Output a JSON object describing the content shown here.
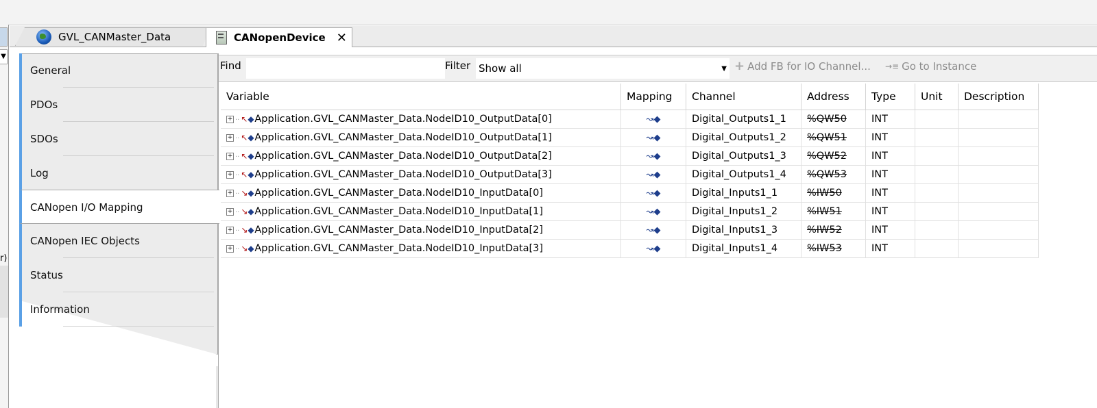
{
  "tabs": [
    {
      "label": "GVL_CANMaster_Data",
      "icon": "globe-icon"
    },
    {
      "label": "CANopenDevice",
      "icon": "device-icon",
      "close": "✕",
      "active": true
    }
  ],
  "sidebar": {
    "items": [
      {
        "label": "General"
      },
      {
        "label": "PDOs"
      },
      {
        "label": "SDOs"
      },
      {
        "label": "Log"
      },
      {
        "label": "CANopen I/O Mapping",
        "active": true
      },
      {
        "label": "CANopen IEC Objects"
      },
      {
        "label": "Status"
      },
      {
        "label": "Information"
      }
    ]
  },
  "toolbar": {
    "find_label": "Find",
    "find_value": "",
    "filter_label": "Filter",
    "filter_value": "Show all",
    "add_fb_label": "Add FB for IO Channel...",
    "goto_label": "Go to Instance"
  },
  "table": {
    "headers": [
      "Variable",
      "Mapping",
      "Channel",
      "Address",
      "Type",
      "Unit",
      "Description"
    ],
    "rows": [
      {
        "variable": "Application.GVL_CANMaster_Data.NodeID10_OutputData[0]",
        "channel": "Digital_Outputs1_1",
        "address": "%QW50",
        "type": "INT",
        "unit": "",
        "description": ""
      },
      {
        "variable": "Application.GVL_CANMaster_Data.NodeID10_OutputData[1]",
        "channel": "Digital_Outputs1_2",
        "address": "%QW51",
        "type": "INT",
        "unit": "",
        "description": ""
      },
      {
        "variable": "Application.GVL_CANMaster_Data.NodeID10_OutputData[2]",
        "channel": "Digital_Outputs1_3",
        "address": "%QW52",
        "type": "INT",
        "unit": "",
        "description": ""
      },
      {
        "variable": "Application.GVL_CANMaster_Data.NodeID10_OutputData[3]",
        "channel": "Digital_Outputs1_4",
        "address": "%QW53",
        "type": "INT",
        "unit": "",
        "description": ""
      },
      {
        "variable": "Application.GVL_CANMaster_Data.NodeID10_InputData[0]",
        "channel": "Digital_Inputs1_1",
        "address": "%IW50",
        "type": "INT",
        "unit": "",
        "description": ""
      },
      {
        "variable": "Application.GVL_CANMaster_Data.NodeID10_InputData[1]",
        "channel": "Digital_Inputs1_2",
        "address": "%IW51",
        "type": "INT",
        "unit": "",
        "description": ""
      },
      {
        "variable": "Application.GVL_CANMaster_Data.NodeID10_InputData[2]",
        "channel": "Digital_Inputs1_3",
        "address": "%IW52",
        "type": "INT",
        "unit": "",
        "description": ""
      },
      {
        "variable": "Application.GVL_CANMaster_Data.NodeID10_InputData[3]",
        "channel": "Digital_Inputs1_4",
        "address": "%IW53",
        "type": "INT",
        "unit": "",
        "description": ""
      }
    ]
  },
  "colors": {
    "accent": "#5aa0e6",
    "disabled_text": "#8c8c8c"
  }
}
